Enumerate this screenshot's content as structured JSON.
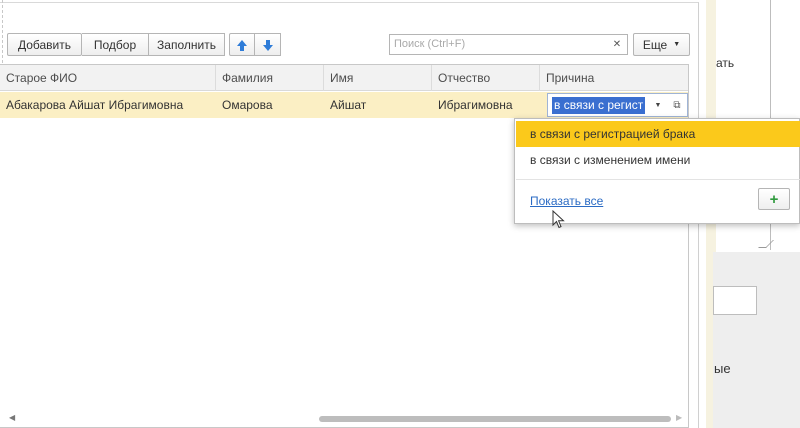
{
  "toolbar": {
    "add_label": "Добавить",
    "select_label": "Подбор",
    "fill_label": "Заполнить",
    "more_label": "Еще",
    "search_placeholder": "Поиск (Ctrl+F)",
    "search_value": ""
  },
  "table": {
    "columns": [
      "Старое ФИО",
      "Фамилия",
      "Имя",
      "Отчество",
      "Причина"
    ],
    "rows": [
      {
        "old_name": "Абакарова Айшат Ибрагимовна",
        "last_name": "Омарова",
        "first_name": "Айшат",
        "patronymic": "Ибрагимовна",
        "reason": "в связи с регист"
      }
    ]
  },
  "dropdown": {
    "options": [
      "в связи с регистрацией брака",
      "в связи с изменением имени"
    ],
    "show_all": "Показать все"
  },
  "side": {
    "text1": "ать",
    "text2": "ые"
  },
  "colors": {
    "selected_row": "#fbefc4",
    "highlight_option": "#fbc91b",
    "text_selection": "#3a6fd0",
    "link": "#2b6bc4",
    "arrow_blue": "#2e7cd8",
    "plus_green": "#2f9a3d"
  }
}
